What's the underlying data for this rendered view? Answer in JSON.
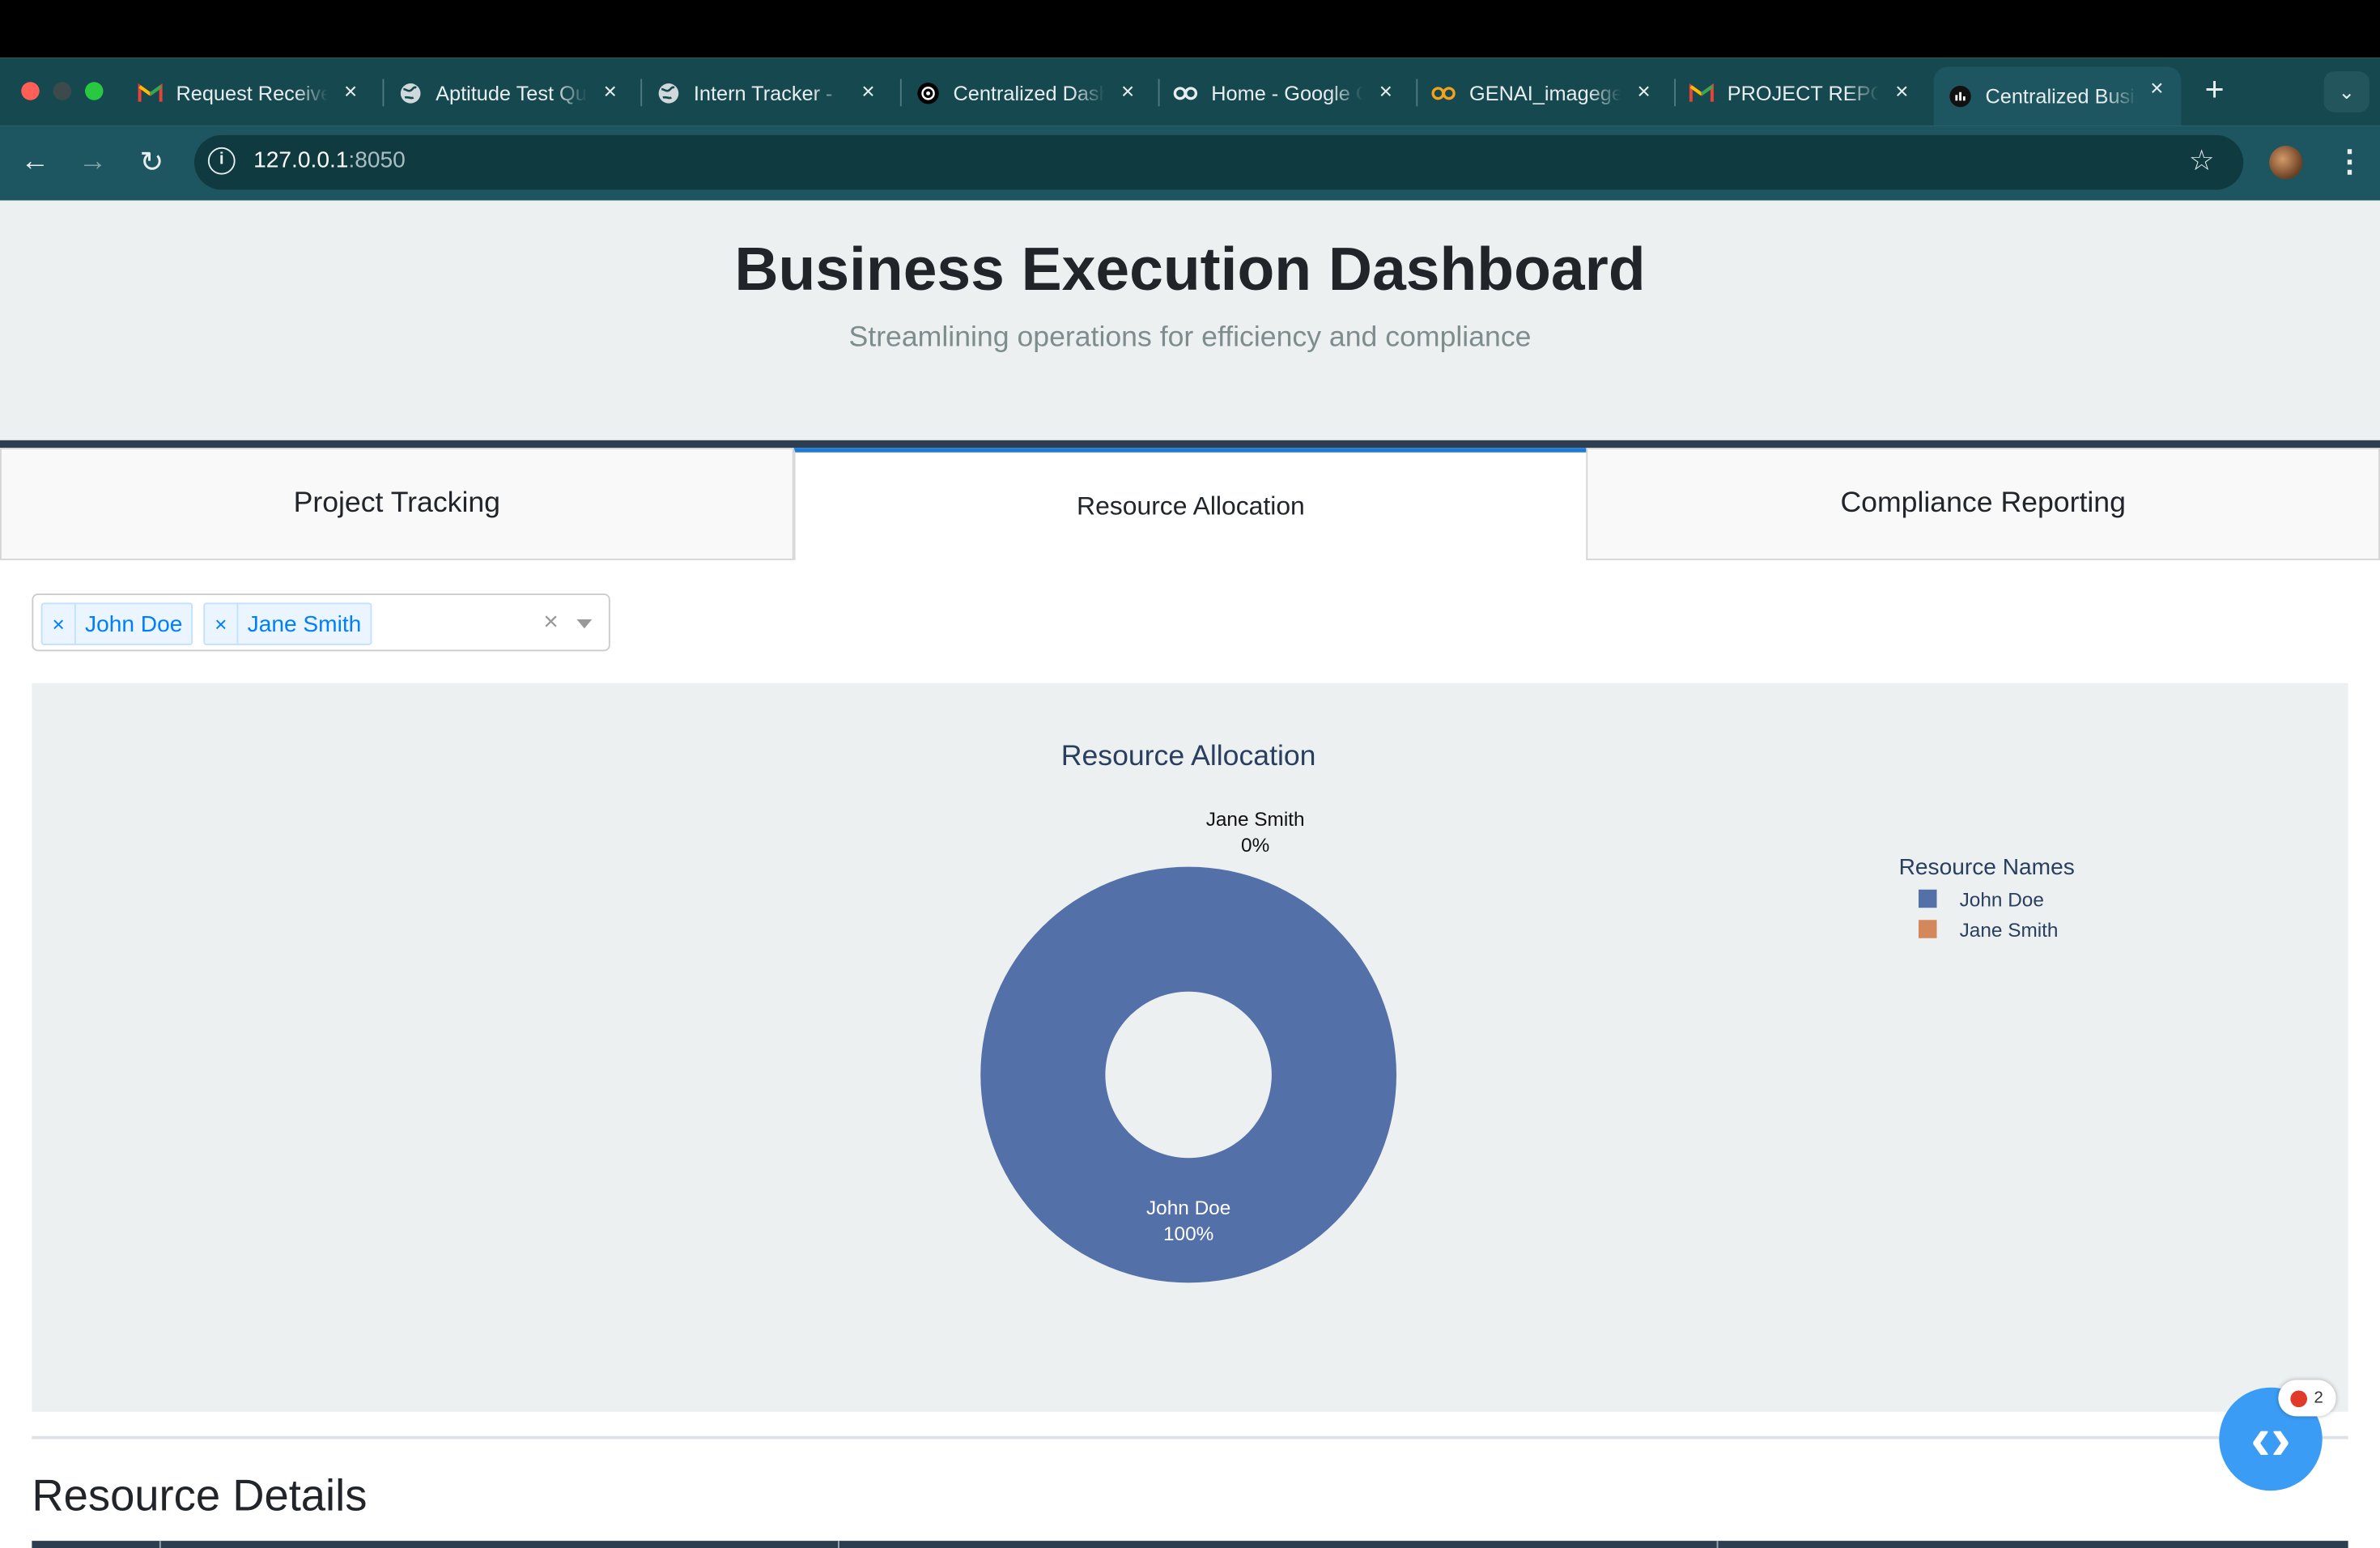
{
  "browser": {
    "tabs": [
      {
        "label": "Request Received",
        "icon": "gmail-icon"
      },
      {
        "label": "Aptitude Test Questions",
        "icon": "globe-icon"
      },
      {
        "label": "Intern Tracker - ",
        "icon": "globe-icon"
      },
      {
        "label": "Centralized Dashboard",
        "icon": "openai-icon"
      },
      {
        "label": "Home - Google Colab",
        "icon": "colab-icon"
      },
      {
        "label": "GENAI_imagegen",
        "icon": "colab-icon"
      },
      {
        "label": "PROJECT REPORT",
        "icon": "gmail-icon"
      },
      {
        "label": "Centralized Business",
        "icon": "dash-icon"
      }
    ],
    "url_host": "127.0.0.1",
    "url_port": ":8050"
  },
  "header": {
    "title": "Business Execution Dashboard",
    "subtitle": "Streamlining operations for efficiency and compliance"
  },
  "tabs": [
    {
      "label": "Project Tracking"
    },
    {
      "label": "Resource Allocation"
    },
    {
      "label": "Compliance Reporting"
    }
  ],
  "filter": {
    "selected": [
      "John Doe",
      "Jane Smith"
    ]
  },
  "chart_data": {
    "type": "pie",
    "title": "Resource Allocation",
    "hole": 0.4,
    "legend_title": "Resource Names",
    "legend_position": "right",
    "labels": [
      "John Doe",
      "Jane Smith"
    ],
    "values": [
      100,
      0
    ],
    "text": [
      "100%",
      "0%"
    ],
    "colors": [
      "#5470a8",
      "#d4875a"
    ]
  },
  "section": {
    "details_title": "Resource Details"
  },
  "fab": {
    "badge_count": "2"
  }
}
